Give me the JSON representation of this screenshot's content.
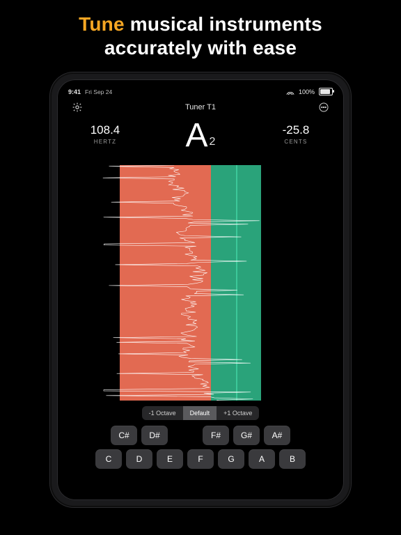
{
  "promo": {
    "accent": "Tune",
    "rest1": "musical instruments",
    "line2": "accurately with ease"
  },
  "status": {
    "time": "9:41",
    "date": "Fri Sep 24",
    "battery_pct": "100%"
  },
  "nav": {
    "title": "Tuner T1"
  },
  "readout": {
    "hz_value": "108.4",
    "hz_label": "HERTZ",
    "note_letter": "A",
    "note_octave": "2",
    "cents_value": "-25.8",
    "cents_label": "CENTS"
  },
  "zones": {
    "red": {
      "left_pct": 18,
      "width_pct": 36
    },
    "green": {
      "left_pct": 54,
      "width_pct": 20
    },
    "center_line_pct": 64
  },
  "octave": {
    "options": [
      "-1 Octave",
      "Default",
      "+1 Octave"
    ],
    "selected_index": 1
  },
  "keys": {
    "sharps": [
      "C#",
      "D#",
      "",
      "F#",
      "G#",
      "A#"
    ],
    "naturals": [
      "C",
      "D",
      "E",
      "F",
      "G",
      "A",
      "B"
    ]
  },
  "colors": {
    "accent": "#f5a623",
    "green": "#2aa37a",
    "red": "#e26a52"
  }
}
